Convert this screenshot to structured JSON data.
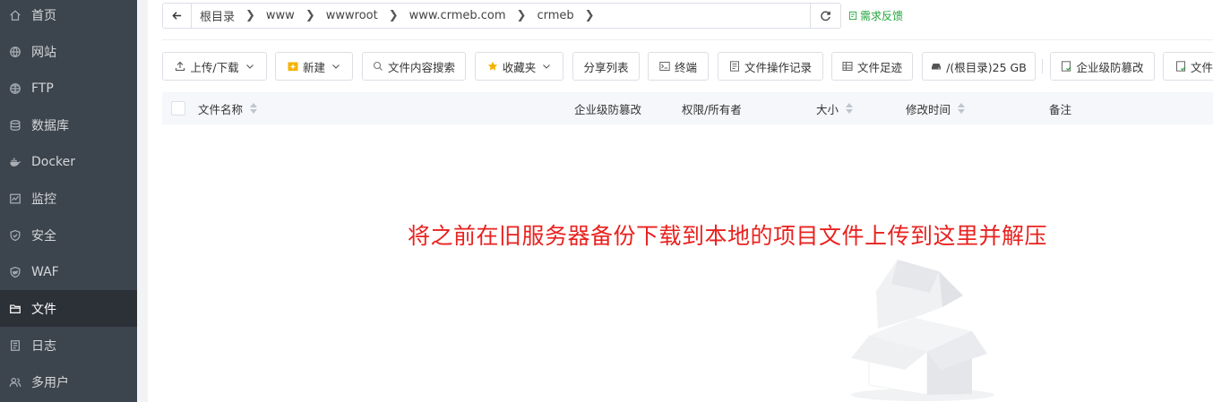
{
  "sidebar": {
    "items": [
      {
        "label": "首页",
        "icon": "home-icon"
      },
      {
        "label": "网站",
        "icon": "globe-icon"
      },
      {
        "label": "FTP",
        "icon": "ftp-icon"
      },
      {
        "label": "数据库",
        "icon": "database-icon"
      },
      {
        "label": "Docker",
        "icon": "docker-icon"
      },
      {
        "label": "监控",
        "icon": "monitor-icon"
      },
      {
        "label": "安全",
        "icon": "shield-icon"
      },
      {
        "label": "WAF",
        "icon": "waf-icon"
      },
      {
        "label": "文件",
        "icon": "folder-icon",
        "active": true
      },
      {
        "label": "日志",
        "icon": "log-icon"
      },
      {
        "label": "多用户",
        "icon": "users-icon"
      }
    ]
  },
  "pathbar": {
    "crumbs": [
      "根目录",
      "www",
      "wwwroot",
      "www.crmeb.com",
      "crmeb"
    ],
    "feedback_label": "需求反馈"
  },
  "toolbar": {
    "upload_label": "上传/下载",
    "new_label": "新建",
    "content_search_label": "文件内容搜索",
    "favorites_label": "收藏夹",
    "share_list_label": "分享列表",
    "terminal_label": "终端",
    "operation_log_label": "文件操作记录",
    "footprint_label": "文件足迹",
    "disk_label": "/(根目录)25 GB",
    "tamper_label": "企业级防篡改",
    "more_label": "文件"
  },
  "table": {
    "columns": [
      "文件名称",
      "企业级防篡改",
      "权限/所有者",
      "大小",
      "修改时间",
      "备注"
    ]
  },
  "annotation": "将之前在旧服务器备份下载到本地的项目文件上传到这里并解压",
  "colors": {
    "sidebar_bg": "#3c444d",
    "sidebar_active": "#2c3138",
    "accent_green": "#20a53a",
    "annotation_red": "#e8221f",
    "folder_yellow": "#f5b300"
  }
}
